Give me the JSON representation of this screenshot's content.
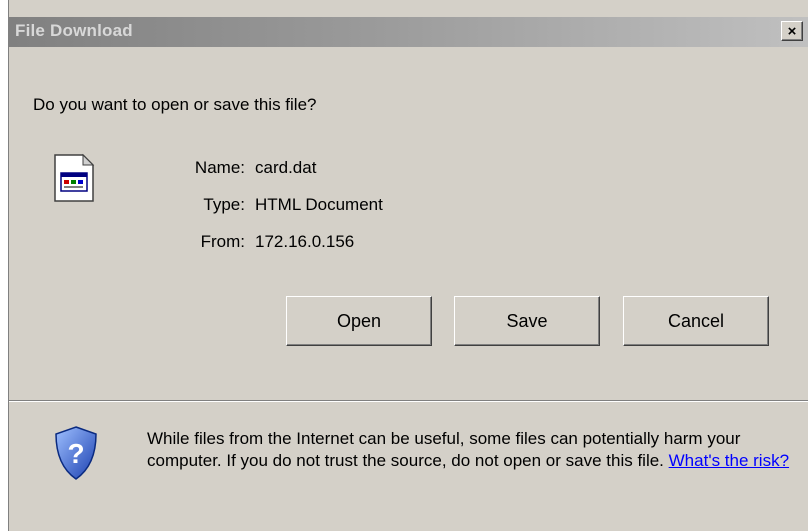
{
  "window": {
    "title": "File Download",
    "close_glyph": "×"
  },
  "prompt": {
    "question": "Do you want to open or save this file?"
  },
  "file": {
    "icon": "html-document-icon",
    "name_label": "Name:",
    "name_value": "card.dat",
    "type_label": "Type:",
    "type_value": "HTML Document",
    "from_label": "From:",
    "from_value": "172.16.0.156"
  },
  "buttons": {
    "open": "Open",
    "save": "Save",
    "cancel": "Cancel"
  },
  "warning": {
    "icon": "shield-question-icon",
    "text": "While files from the Internet can be useful, some files can potentially harm your computer. If you do not trust the source, do not open or save this file.",
    "link": "What's the risk?"
  },
  "colors": {
    "dialog_bg": "#d4d0c8",
    "title_bar": "#808080",
    "link": "#0000ff"
  }
}
